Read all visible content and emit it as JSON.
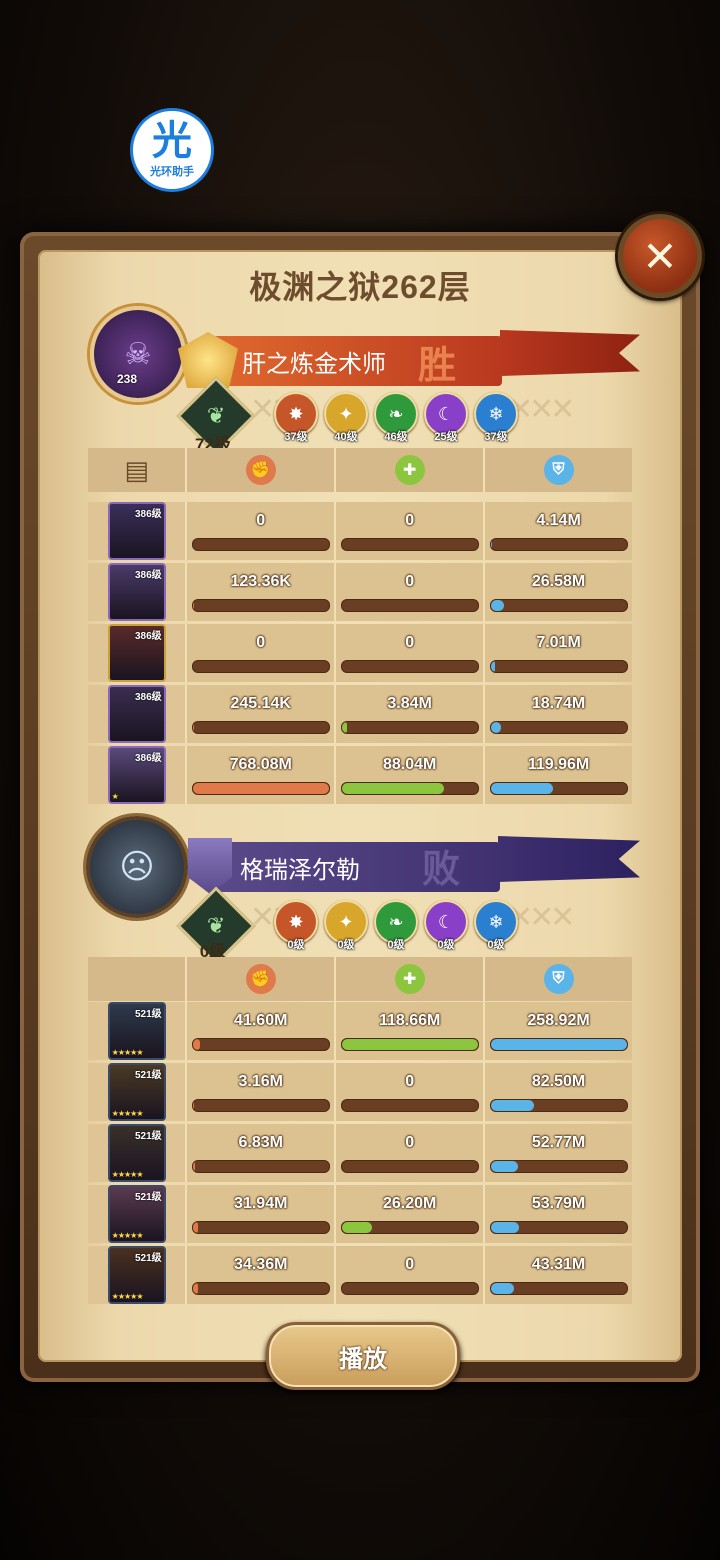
{
  "watermark": {
    "glyph": "光",
    "text": "光环助手"
  },
  "close_icon": "close-icon",
  "title": "极渊之狱262层",
  "colors": {
    "damage": "#e07a4a",
    "heal": "#8cc63f",
    "shield": "#5ab4e8",
    "win_banner": "#c8452a",
    "lose_banner": "#4b3a78"
  },
  "teams": [
    {
      "name": "肝之炼金术师",
      "result": "胜",
      "avatar_level": "238",
      "crest_level": "72级",
      "factions": [
        {
          "icon": "fire-faction-icon",
          "level": "37级"
        },
        {
          "icon": "light-faction-icon",
          "level": "40级"
        },
        {
          "icon": "nature-faction-icon",
          "level": "46级"
        },
        {
          "icon": "arcane-faction-icon",
          "level": "25级"
        },
        {
          "icon": "water-faction-icon",
          "level": "37级"
        }
      ],
      "heroes": [
        {
          "level": "386级",
          "stars": "",
          "damage": "0",
          "heal": "0",
          "shield": "4.14M",
          "damage_pct": 0,
          "heal_pct": 0,
          "shield_pct": 1
        },
        {
          "level": "386级",
          "stars": "",
          "damage": "123.36K",
          "heal": "0",
          "shield": "26.58M",
          "damage_pct": 0.1,
          "heal_pct": 0,
          "shield_pct": 10
        },
        {
          "level": "386级",
          "stars": "",
          "damage": "0",
          "heal": "0",
          "shield": "7.01M",
          "damage_pct": 0,
          "heal_pct": 0,
          "shield_pct": 3
        },
        {
          "level": "386级",
          "stars": "",
          "damage": "245.14K",
          "heal": "3.84M",
          "shield": "18.74M",
          "damage_pct": 0.1,
          "heal_pct": 4,
          "shield_pct": 8
        },
        {
          "level": "386级",
          "stars": "★",
          "damage": "768.08M",
          "heal": "88.04M",
          "shield": "119.96M",
          "damage_pct": 100,
          "heal_pct": 75,
          "shield_pct": 46
        }
      ]
    },
    {
      "name": "格瑞泽尔勒",
      "result": "败",
      "avatar_level": "",
      "crest_level": "0级",
      "factions": [
        {
          "icon": "fire-faction-icon",
          "level": "0级"
        },
        {
          "icon": "light-faction-icon",
          "level": "0级"
        },
        {
          "icon": "nature-faction-icon",
          "level": "0级"
        },
        {
          "icon": "arcane-faction-icon",
          "level": "0级"
        },
        {
          "icon": "water-faction-icon",
          "level": "0级"
        }
      ],
      "heroes": [
        {
          "level": "521级",
          "stars": "★★★★★",
          "damage": "41.60M",
          "heal": "118.66M",
          "shield": "258.92M",
          "damage_pct": 5,
          "heal_pct": 100,
          "shield_pct": 100
        },
        {
          "level": "521级",
          "stars": "★★★★★",
          "damage": "3.16M",
          "heal": "0",
          "shield": "82.50M",
          "damage_pct": 1,
          "heal_pct": 0,
          "shield_pct": 32
        },
        {
          "level": "521级",
          "stars": "★★★★★",
          "damage": "6.83M",
          "heal": "0",
          "shield": "52.77M",
          "damage_pct": 2,
          "heal_pct": 0,
          "shield_pct": 20
        },
        {
          "level": "521级",
          "stars": "★★★★★",
          "damage": "31.94M",
          "heal": "26.20M",
          "shield": "53.79M",
          "damage_pct": 4,
          "heal_pct": 22,
          "shield_pct": 21
        },
        {
          "level": "521级",
          "stars": "★★★★★",
          "damage": "34.36M",
          "heal": "0",
          "shield": "43.31M",
          "damage_pct": 4,
          "heal_pct": 0,
          "shield_pct": 17
        }
      ]
    }
  ],
  "play_label": "播放"
}
